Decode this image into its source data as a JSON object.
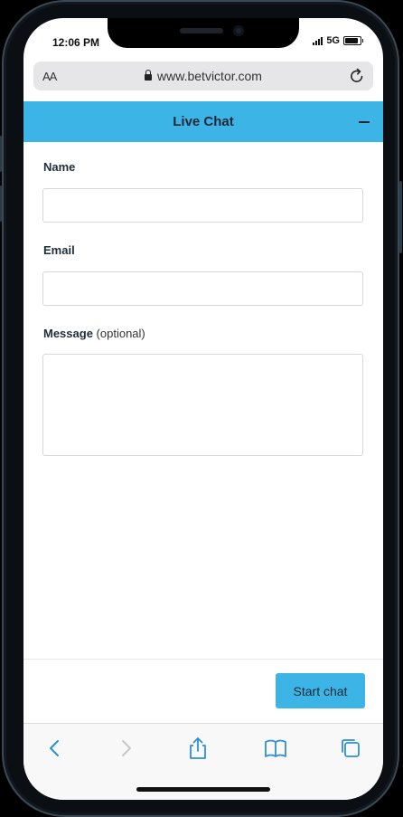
{
  "status": {
    "time": "12:06 PM",
    "network": "5G"
  },
  "browser": {
    "text_size": "AA",
    "url": "www.betvictor.com"
  },
  "chat": {
    "title": "Live Chat",
    "name_label": "Name",
    "email_label": "Email",
    "message_label": "Message",
    "message_optional": "(optional)",
    "name_value": "",
    "email_value": "",
    "message_value": "",
    "start_button": "Start chat"
  },
  "colors": {
    "accent": "#3db4e6",
    "header_text": "#1b2838"
  },
  "toolbar_icons": [
    "back-icon",
    "forward-icon",
    "share-icon",
    "bookmarks-icon",
    "tabs-icon"
  ]
}
